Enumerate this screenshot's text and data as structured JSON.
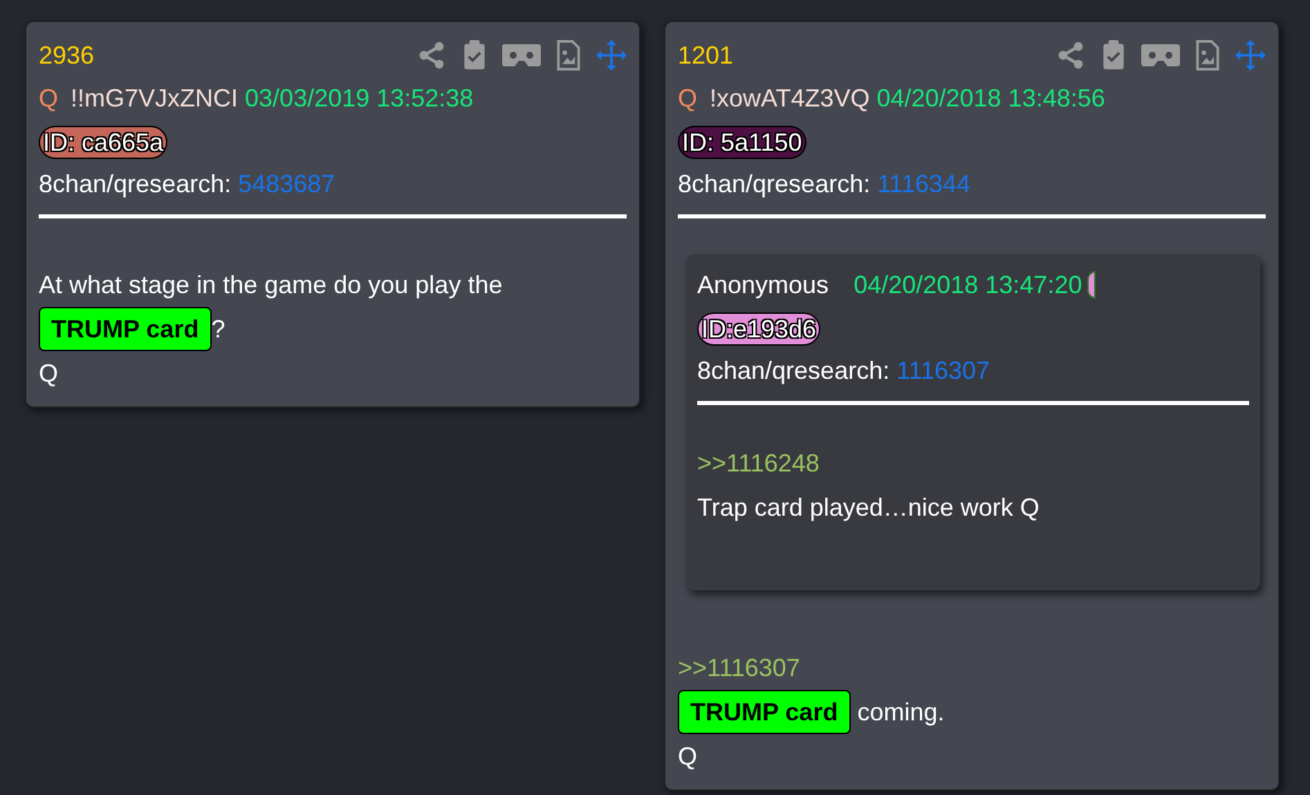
{
  "posts": [
    {
      "number": "2936",
      "author": "Q",
      "tripcode": "!!mG7VJxZNCI",
      "datetime": "03/03/2019 13:52:38",
      "id": {
        "text": "ID: ca665a",
        "color": "#c4675a"
      },
      "board": "8chan/qresearch:",
      "post_link": "5483687",
      "body": [
        [
          {
            "kind": "text",
            "text": "At what stage in the game do you play the"
          }
        ],
        [
          {
            "kind": "highlight",
            "text": "TRUMP card"
          },
          {
            "kind": "text",
            "text": "?"
          }
        ],
        [
          {
            "kind": "text",
            "text": "Q"
          }
        ]
      ]
    },
    {
      "number": "1201",
      "author": "Q",
      "tripcode": "!xowAT4Z3VQ",
      "datetime": "04/20/2018 13:48:56",
      "id": {
        "text": "ID: 5a1150",
        "color": "#4e0f42"
      },
      "board": "8chan/qresearch:",
      "post_link": "1116344",
      "quoted": {
        "author": "Anonymous",
        "datetime": "04/20/2018 13:47:20",
        "id": {
          "text": "ID:e193d6",
          "color": "#e08ed8"
        },
        "board": "8chan/qresearch:",
        "post_link": "1116307",
        "body": [
          [
            {
              "kind": "quote",
              "text": ">>1116248"
            }
          ],
          [
            {
              "kind": "text",
              "text": "Trap card played…nice work Q"
            }
          ]
        ]
      },
      "body": [
        [
          {
            "kind": "quote",
            "text": ">>1116307"
          }
        ],
        [
          {
            "kind": "highlight",
            "text": "TRUMP card"
          },
          {
            "kind": "text",
            "text": " coming."
          }
        ],
        [
          {
            "kind": "text",
            "text": "Q"
          }
        ]
      ]
    }
  ]
}
